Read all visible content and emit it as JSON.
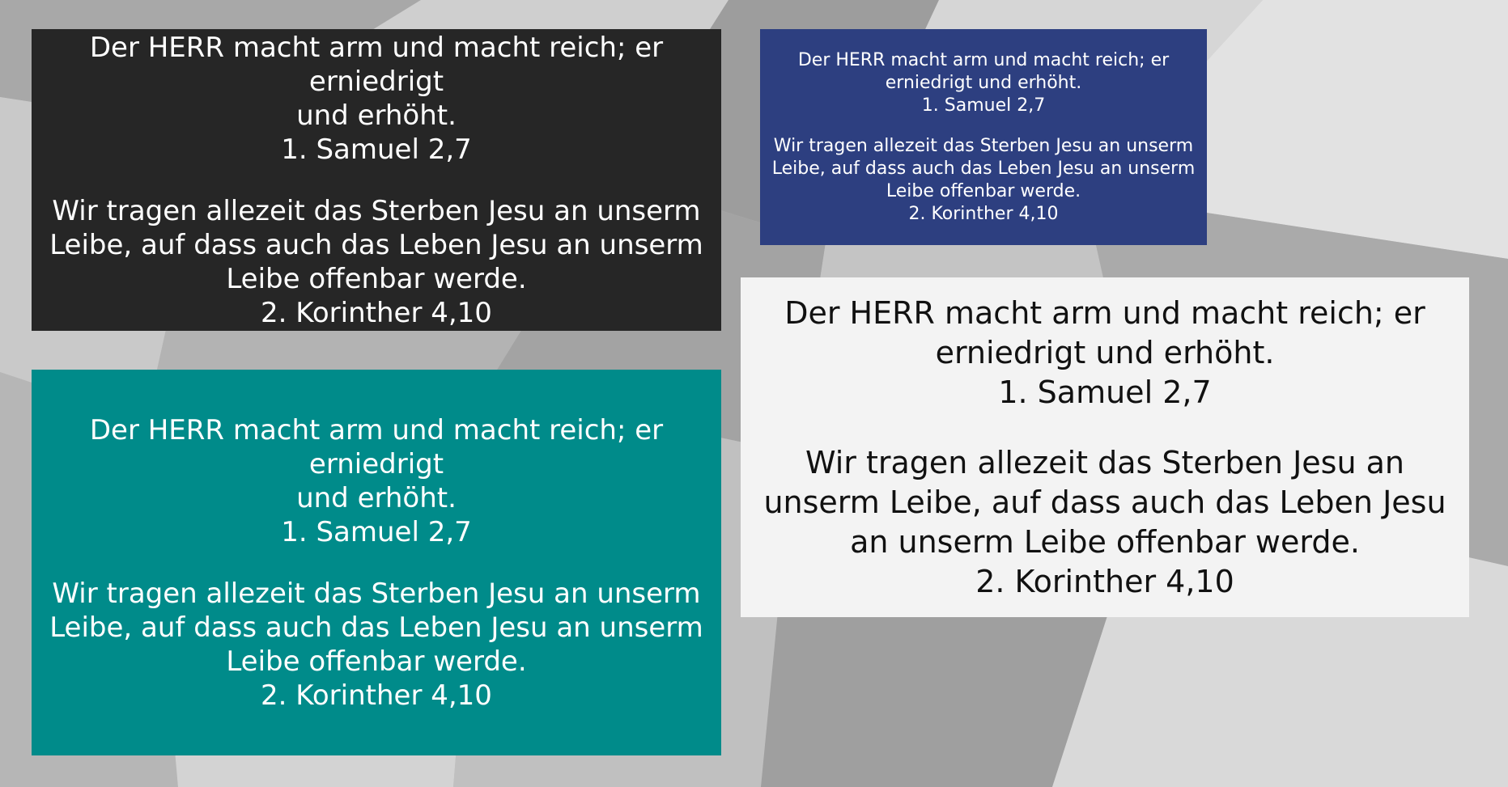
{
  "colors": {
    "page_background": "#bdbdbd",
    "dark_card": "#262626",
    "teal_card": "#008b8a",
    "navy_card": "#2d3f80",
    "light_card": "#f3f3f3"
  },
  "cards": [
    {
      "variant": "dark",
      "verse1_text": "Der HERR macht arm und macht reich; er erniedrigt\nund erhöht.",
      "verse1_ref": "1. Samuel 2,7",
      "verse2_text": "Wir tragen allezeit das Sterben Jesu an unserm\nLeibe, auf dass auch das Leben Jesu an unserm\nLeibe offenbar werde.",
      "verse2_ref": "2. Korinther 4,10"
    },
    {
      "variant": "navy",
      "verse1_text": "Der HERR macht arm und macht reich; er\nerniedrigt und erhöht.",
      "verse1_ref": "1. Samuel 2,7",
      "verse2_text": "Wir tragen allezeit das Sterben Jesu an unserm\nLeibe, auf dass auch das Leben Jesu an unserm\nLeibe offenbar werde.",
      "verse2_ref": "2. Korinther 4,10"
    },
    {
      "variant": "teal",
      "verse1_text": "Der HERR macht arm und macht reich; er erniedrigt\nund erhöht.",
      "verse1_ref": "1. Samuel 2,7",
      "verse2_text": "Wir tragen allezeit das Sterben Jesu an unserm\nLeibe, auf dass auch das Leben Jesu an unserm\nLeibe offenbar werde.",
      "verse2_ref": "2. Korinther 4,10"
    },
    {
      "variant": "light",
      "verse1_text": "Der HERR macht arm und macht reich; er\nerniedrigt und erhöht.",
      "verse1_ref": "1. Samuel 2,7",
      "verse2_text": "Wir tragen allezeit das Sterben Jesu an\nunserm Leibe, auf dass auch das Leben Jesu\nan unserm Leibe offenbar werde.",
      "verse2_ref": "2. Korinther 4,10"
    }
  ]
}
